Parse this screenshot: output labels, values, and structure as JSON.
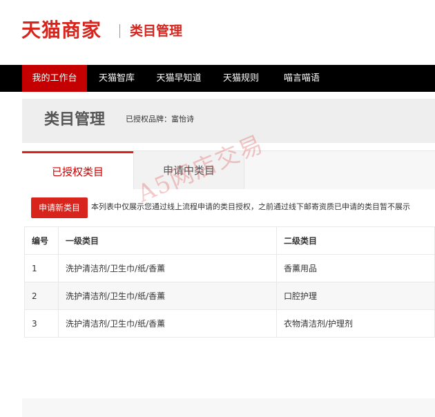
{
  "header": {
    "logo_text": "天猫商家",
    "section_title": "类目管理"
  },
  "nav": {
    "items": [
      {
        "label": "我的工作台",
        "active": true
      },
      {
        "label": "天猫智库",
        "active": false
      },
      {
        "label": "天猫早知道",
        "active": false
      },
      {
        "label": "天猫规则",
        "active": false
      },
      {
        "label": "喵言喵语",
        "active": false
      }
    ]
  },
  "page": {
    "title": "类目管理",
    "brand_label": "已授权品牌：富怡诗"
  },
  "tabs": [
    {
      "label": "已授权类目",
      "active": true
    },
    {
      "label": "申请中类目",
      "active": false
    }
  ],
  "toolbar": {
    "apply_label": "申请新类目",
    "notice": "本列表中仅展示您通过线上流程申请的类目授权，之前通过线下邮寄资质已申请的类目暂不展示"
  },
  "table": {
    "headers": [
      "编号",
      "一级类目",
      "二级类目"
    ],
    "rows": [
      [
        "1",
        "洗护清洁剂/卫生巾/纸/香薰",
        "香薰用品"
      ],
      [
        "2",
        "洗护清洁剂/卫生巾/纸/香薰",
        "口腔护理"
      ],
      [
        "3",
        "洗护清洁剂/卫生巾/纸/香薰",
        "衣物清洁剂/护理剂"
      ]
    ]
  },
  "watermark": "A5网店交易",
  "colors": {
    "brand_red": "#d7251d",
    "nav_bg": "#000000",
    "nav_active": "#c40000"
  }
}
